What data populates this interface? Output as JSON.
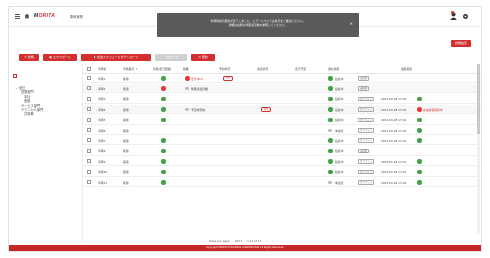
{
  "header": {
    "logo_prefix": "M",
    "logo_red": "ORITA",
    "logo_sub": "車両管理",
    "icons": [
      "hamburger-icon",
      "home-icon",
      "user-icon",
      "gear-icon"
    ]
  },
  "toast": {
    "line1": "車両情報の更新が完了しました。エラーについては各行をご確認ください。",
    "line2": "詳細は右側の状態表示欄を参照してください。",
    "close": "×"
  },
  "toolbar": {
    "new_label": "新規",
    "import_label": "エクスポート",
    "schedule_label": "充電スケジュールダウンロード",
    "disabled_label": "一括ロック",
    "refresh_label": "更新",
    "right_label": "詳細設定"
  },
  "nav": {
    "tree": [
      "全社",
      "営業部門",
      "本社",
      "東部",
      "サービス部門",
      "テクニカル部門",
      "共有車"
    ]
  },
  "table": {
    "headers": [
      "車両名",
      "車両番号 ↑",
      "状態/走行距離",
      "稼働",
      "予約状況",
      "承認状況",
      "走行予定",
      "通信状態",
      "通信状態",
      "最終更新"
    ],
    "rows": [
      {
        "name": "車両1",
        "type": "乗用",
        "dot1": "g",
        "status_dot": "r",
        "status": "走行中(2)",
        "pill": "1件",
        "pill2": "",
        "conn": "g",
        "conn_label": "接続中",
        "tag": "未取得",
        "date": "",
        "dot_end": "",
        "end_label": ""
      },
      {
        "name": "車両2",
        "type": "乗用",
        "dot1": "r",
        "status_dot": "gr",
        "status": "整備点検待機",
        "pill": "",
        "pill2": "",
        "conn": "g",
        "conn_label": "接続中",
        "tag": "未取得",
        "date": "",
        "dot_end": "",
        "end_label": ""
      },
      {
        "name": "車両3",
        "type": "乗用",
        "dot1": "g",
        "status_dot": "",
        "status": "",
        "pill": "",
        "pill2": "",
        "conn": "g",
        "conn_label": "接続中",
        "tag": "オフライン",
        "date": "2023-03-28 17:04",
        "dot_end": "g",
        "end_label": ""
      },
      {
        "name": "車両4",
        "type": "乗用",
        "dot1": "g",
        "status_dot": "gr",
        "status": "予定未登録",
        "pill": "",
        "pill2": "2件",
        "conn": "g",
        "conn_label": "接続中",
        "tag": "オフライン",
        "date": "2023-03-28 17:04",
        "dot_end": "r",
        "end_label": "充電情報取得中"
      },
      {
        "name": "車両5",
        "type": "乗用",
        "dot1": "g",
        "status_dot": "",
        "status": "",
        "pill": "",
        "pill2": "",
        "conn": "g",
        "conn_label": "接続中",
        "tag": "オフライン",
        "date": "2023-03-28 17:04",
        "dot_end": "g",
        "end_label": ""
      },
      {
        "name": "車両6",
        "type": "乗用",
        "dot1": "",
        "status_dot": "",
        "status": "",
        "pill": "",
        "pill2": "",
        "conn": "gr",
        "conn_label": "未接続",
        "tag": "オフライン",
        "date": "2023-03-28 17:04",
        "dot_end": "g",
        "end_label": ""
      },
      {
        "name": "車両7",
        "type": "乗用",
        "dot1": "g",
        "status_dot": "",
        "status": "",
        "pill": "",
        "pill2": "",
        "conn": "g",
        "conn_label": "接続中",
        "tag": "オフライン",
        "date": "2023-03-28 17:04",
        "dot_end": "g",
        "end_label": ""
      },
      {
        "name": "車両8",
        "type": "乗用",
        "dot1": "g",
        "status_dot": "",
        "status": "",
        "pill": "",
        "pill2": "",
        "conn": "g",
        "conn_label": "接続中",
        "tag": "未取得",
        "date": "",
        "dot_end": "",
        "end_label": ""
      },
      {
        "name": "車両9",
        "type": "乗用",
        "dot1": "g",
        "status_dot": "",
        "status": "",
        "pill": "",
        "pill2": "",
        "conn": "g",
        "conn_label": "接続中",
        "tag": "オフライン",
        "date": "2023-03-28 17:04",
        "dot_end": "g",
        "end_label": ""
      },
      {
        "name": "車両10",
        "type": "乗用",
        "dot1": "g",
        "status_dot": "",
        "status": "",
        "pill": "",
        "pill2": "",
        "conn": "g",
        "conn_label": "接続中",
        "tag": "オフライン",
        "date": "2023-03-28 17:04",
        "dot_end": "g",
        "end_label": ""
      },
      {
        "name": "車両11",
        "type": "乗用",
        "dot1": "g",
        "status_dot": "",
        "status": "",
        "pill": "",
        "pill2": "",
        "conn": "gr",
        "conn_label": "未接続",
        "tag": "オフライン",
        "date": "2023-03-28 17:04",
        "dot_end": "g",
        "end_label": ""
      }
    ]
  },
  "pager": {
    "rows_label": "Rows per page",
    "rows_value": "100 ▾",
    "range": "1-11 of 11",
    "prev": "‹",
    "next": "›"
  },
  "footer": {
    "text": "Copyright MORITA HOLDINGS CORPORATION All Rights Reserved."
  },
  "colors": {
    "brand_red": "#d32f2f",
    "ok_green": "#43a047",
    "alert_red": "#e53935",
    "toast_bg": "#5a5a5a"
  }
}
